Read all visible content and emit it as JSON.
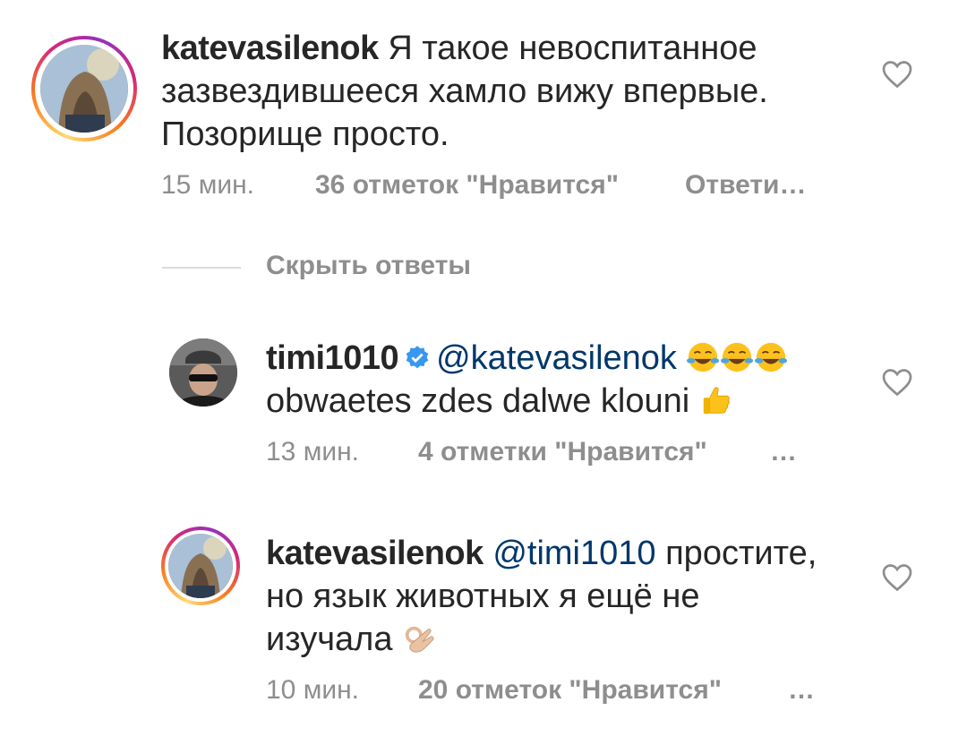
{
  "comments": [
    {
      "username": "katevasilenok",
      "text": "Я такое невоспитанное зазвездившееся хамло вижу впервые. Позорище просто.",
      "time": "15 мин.",
      "likes": "36 отметок \"Нравится\"",
      "reply": "Ответи…",
      "avatar": "avatar-photo",
      "heart_icon": "heart-outline-icon"
    },
    {
      "username": "timi1010",
      "mention": "@katevasilenok",
      "emojis_1": [
        "face-with-tears-of-joy-emoji",
        "face-with-tears-of-joy-emoji",
        "face-with-tears-of-joy-emoji"
      ],
      "text": "obwaetes zdes dalwe klouni",
      "emoji_2": "thumbs-up-emoji",
      "time": "13 мин.",
      "likes": "4 отметки \"Нравится\"",
      "more": "…",
      "verified_icon": "verified-badge-icon",
      "heart_icon": "heart-outline-icon"
    },
    {
      "username": "katevasilenok",
      "mention": "@timi1010",
      "text_line1": "простите,",
      "text_line2": "но язык животных я ещё не",
      "text_line3": "изучала",
      "emoji": "ok-hand-emoji",
      "time": "10 мин.",
      "likes": "20 отметок \"Нравится\"",
      "more": "…",
      "heart_icon": "heart-outline-icon"
    }
  ],
  "replies_toggle": "Скрыть ответы",
  "colors": {
    "text": "#262626",
    "secondary": "#8e8e8e",
    "mention": "#00376b",
    "verified": "#3897f0",
    "divider": "#dbdbdb"
  }
}
